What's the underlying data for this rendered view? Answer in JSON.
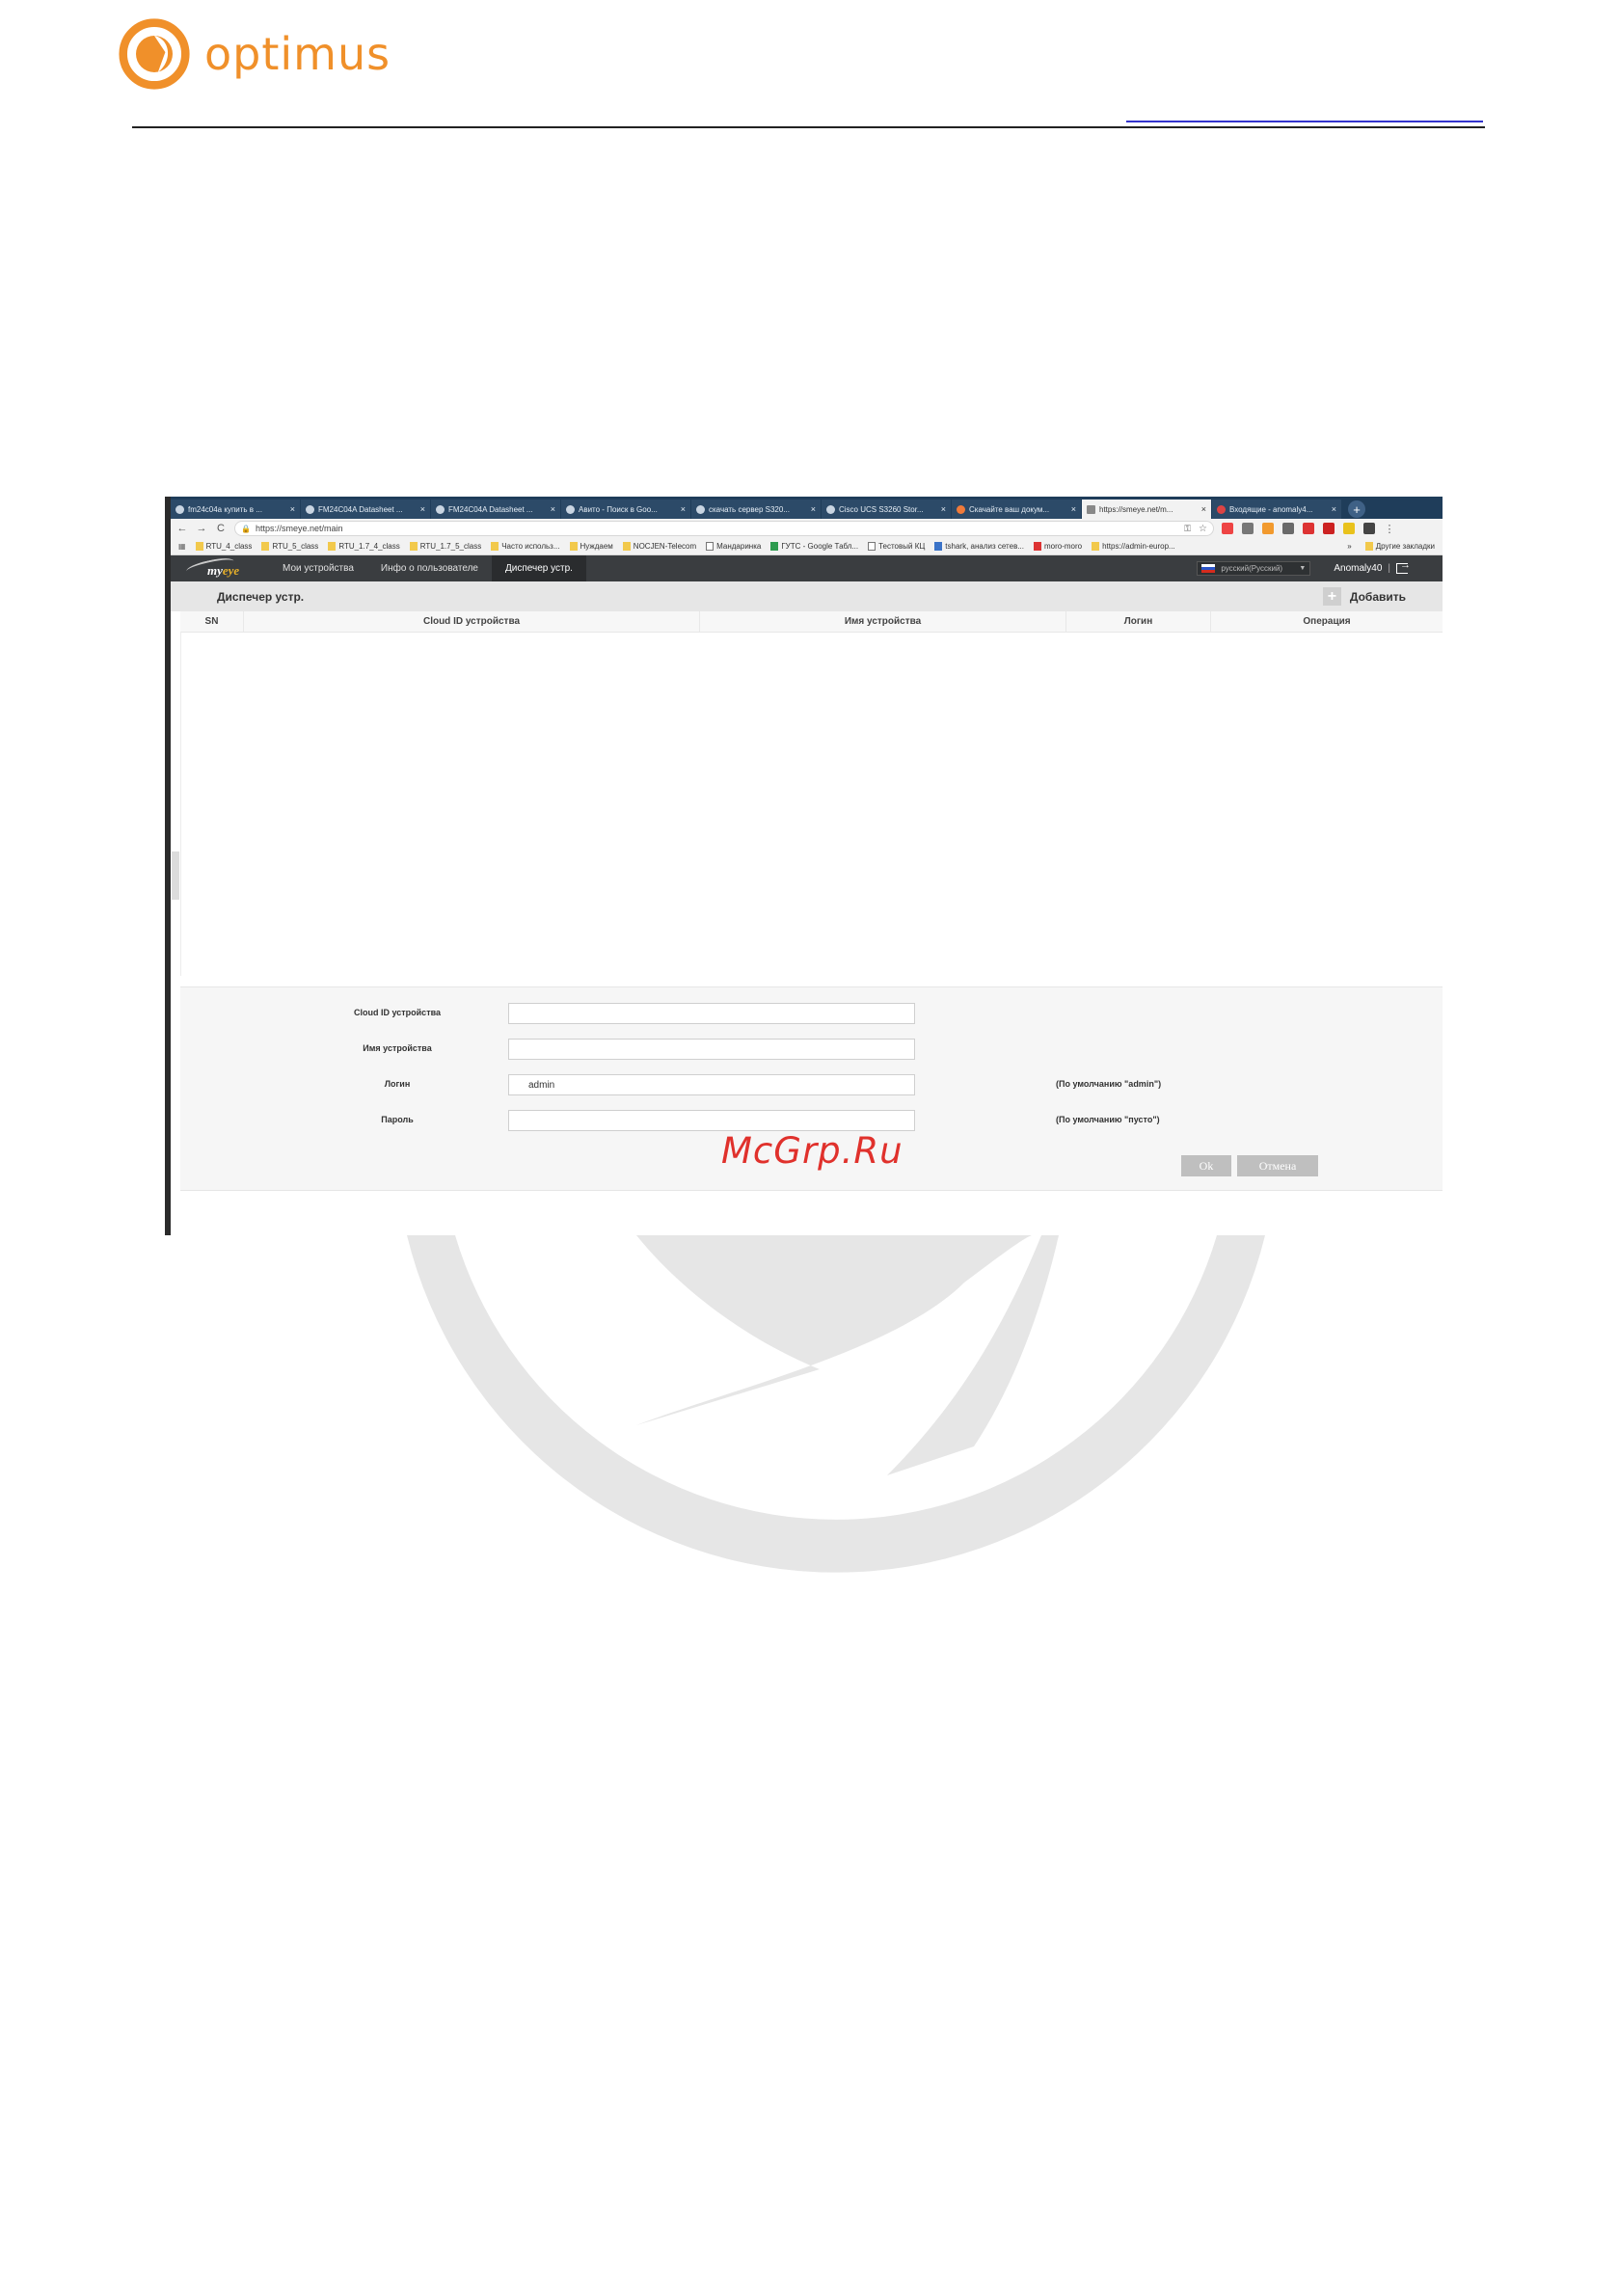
{
  "document": {
    "logo_text": "optimus",
    "watermark_text": "McGrp.Ru",
    "colors": {
      "brand_orange": "#f0902a",
      "watermark_red": "#e0312c",
      "link_blue": "#3333cc"
    }
  },
  "browser": {
    "tabs": [
      {
        "label": "fm24c04a купить в ...",
        "icon": "globe-icon"
      },
      {
        "label": "FM24C04A Datasheet ...",
        "icon": "page-icon"
      },
      {
        "label": "FM24C04A Datasheet ...",
        "icon": "page-icon"
      },
      {
        "label": "Авито - Поиск в Goo...",
        "icon": "google-icon"
      },
      {
        "label": "скачать сервер S320...",
        "icon": "google-icon"
      },
      {
        "label": "Cisco UCS S3260 Stor...",
        "icon": "grid-icon"
      },
      {
        "label": "Скачайте ваш докум...",
        "icon": "orange-icon"
      },
      {
        "label": "https://smeye.net/m...",
        "icon": "page-icon",
        "active": true
      },
      {
        "label": "Входящие - anomaly4...",
        "icon": "mail-icon"
      }
    ],
    "new_tab": "+",
    "url": "https://smeye.net/main",
    "bookmarks": [
      {
        "label": "RTU_4_class",
        "kind": "folder"
      },
      {
        "label": "RTU_5_class",
        "kind": "folder"
      },
      {
        "label": "RTU_1.7_4_class",
        "kind": "folder"
      },
      {
        "label": "RTU_1.7_5_class",
        "kind": "folder"
      },
      {
        "label": "Часто использ...",
        "kind": "folder"
      },
      {
        "label": "Нуждаем",
        "kind": "folder"
      },
      {
        "label": "NOCJEN-Telecom",
        "kind": "folder"
      },
      {
        "label": "Мандаринка",
        "kind": "page"
      },
      {
        "label": "ГУТС - Google Табл...",
        "kind": "green"
      },
      {
        "label": "Тестовый КЦ",
        "kind": "page"
      },
      {
        "label": "tshark, анализ сетев...",
        "kind": "blue"
      },
      {
        "label": "moro-moro",
        "kind": "red"
      },
      {
        "label": "https://admin-europ...",
        "kind": "folder"
      }
    ],
    "bookmarks_more": "»",
    "bookmarks_other": "Другие закладки"
  },
  "app": {
    "logo": {
      "prefix": "my",
      "accent": "eye"
    },
    "nav": [
      {
        "label": "Мои устройства",
        "active": false
      },
      {
        "label": "Инфо о пользователе",
        "active": false
      },
      {
        "label": "Диспечер устр.",
        "active": true
      }
    ],
    "language": "русский(Русский)",
    "username": "Anomaly40",
    "separator": "|"
  },
  "page": {
    "title": "Диспечер устр.",
    "add_label": "Добавить",
    "table": {
      "columns": [
        "SN",
        "Cloud ID устройства",
        "Имя устройства",
        "Логин",
        "Операция"
      ],
      "rows": []
    },
    "form": {
      "cloud_id_label": "Cloud ID устройства",
      "cloud_id_value": "",
      "name_label": "Имя устройства",
      "name_value": "",
      "login_label": "Логин",
      "login_value": "admin",
      "login_hint": "(По умолчанию \"admin\")",
      "password_label": "Пароль",
      "password_value": "",
      "password_hint": "(По умолчанию \"пусто\")",
      "ok_label": "Ok",
      "cancel_label": "Отмена"
    }
  }
}
